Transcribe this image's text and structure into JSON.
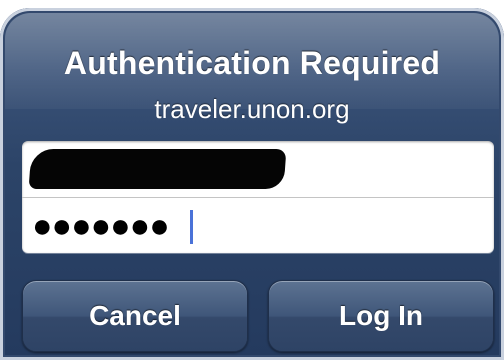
{
  "dialog": {
    "title": "Authentication Required",
    "host": "traveler.unon.org"
  },
  "fields": {
    "username_value": "",
    "password_value": "●●●●●●●"
  },
  "buttons": {
    "cancel_label": "Cancel",
    "login_label": "Log In"
  },
  "colors": {
    "dialog_background": "#2c4468",
    "caret": "#4a72d8"
  }
}
